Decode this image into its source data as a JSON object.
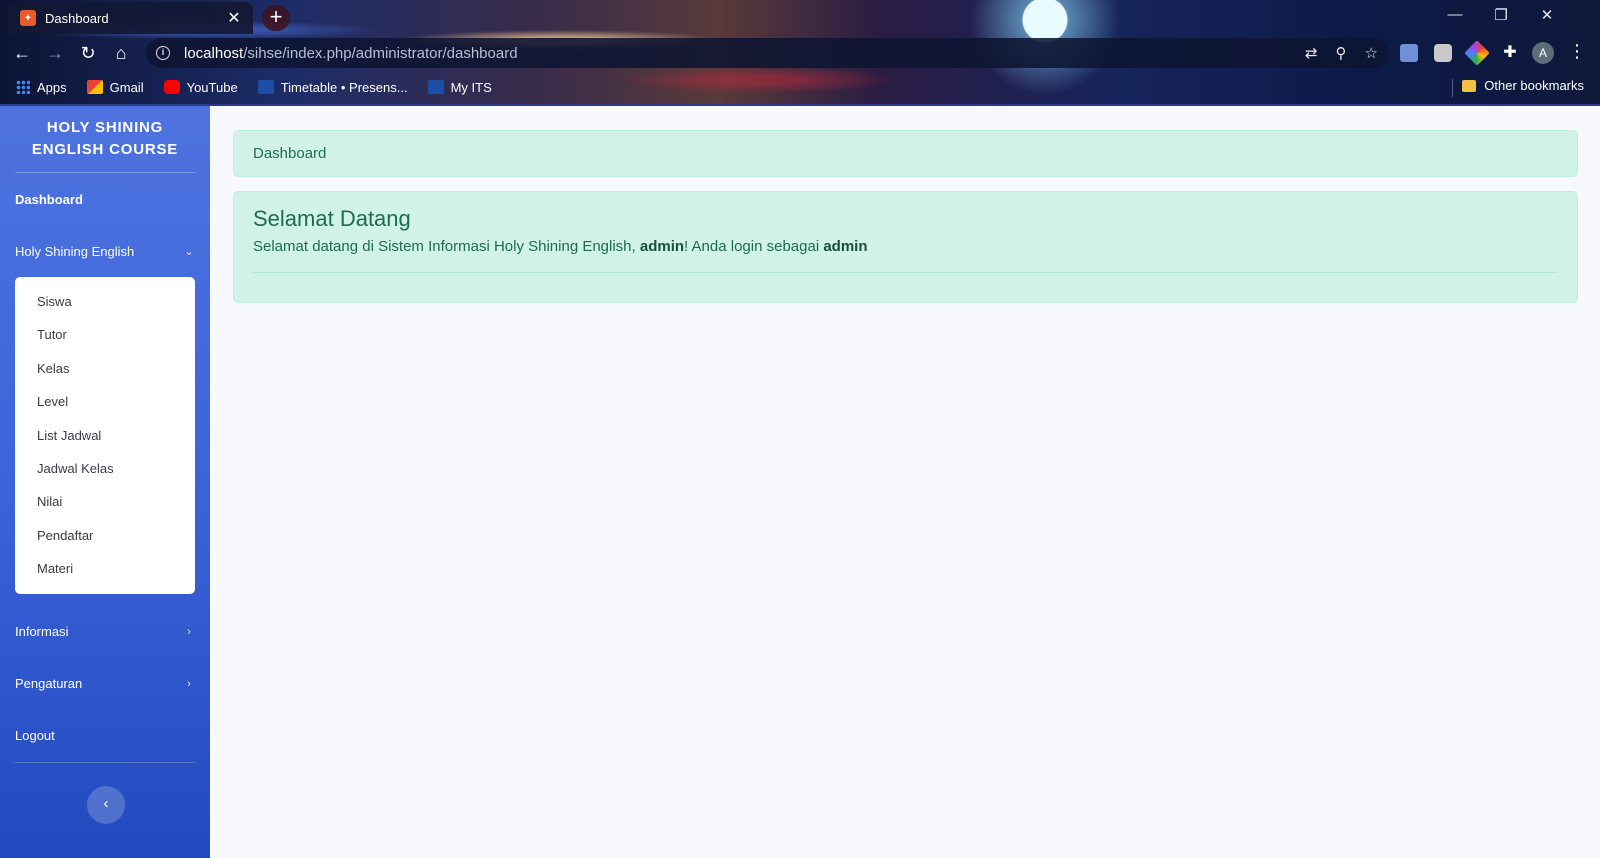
{
  "browser": {
    "tab_title": "Dashboard",
    "tab_close": "✕",
    "new_tab": "+",
    "url_host": "localhost",
    "url_path": "/sihse/index.php/administrator/dashboard",
    "avatar_letter": "A",
    "bookmarks": [
      "Apps",
      "Gmail",
      "YouTube",
      "Timetable • Presens...",
      "My ITS"
    ],
    "other_bookmarks": "Other bookmarks",
    "accent": "#4e73df"
  },
  "sidebar": {
    "brand": "HOLY SHINING ENGLISH COURSE",
    "dashboard": "Dashboard",
    "group_hse": "Holy Shining English",
    "submenu": [
      "Siswa",
      "Tutor",
      "Kelas",
      "Level",
      "List Jadwal",
      "Jadwal Kelas",
      "Nilai",
      "Pendaftar",
      "Materi"
    ],
    "informasi": "Informasi",
    "pengaturan": "Pengaturan",
    "logout": "Logout",
    "toggle": "‹"
  },
  "main": {
    "breadcrumb": "Dashboard",
    "welcome_title": "Selamat Datang",
    "welcome_text_1": "Selamat datang di Sistem Informasi Holy Shining English, ",
    "welcome_user": "admin",
    "welcome_text_2": "! Anda login sebagai ",
    "welcome_role": "admin",
    "alert_bg": "#d1f2e6"
  }
}
